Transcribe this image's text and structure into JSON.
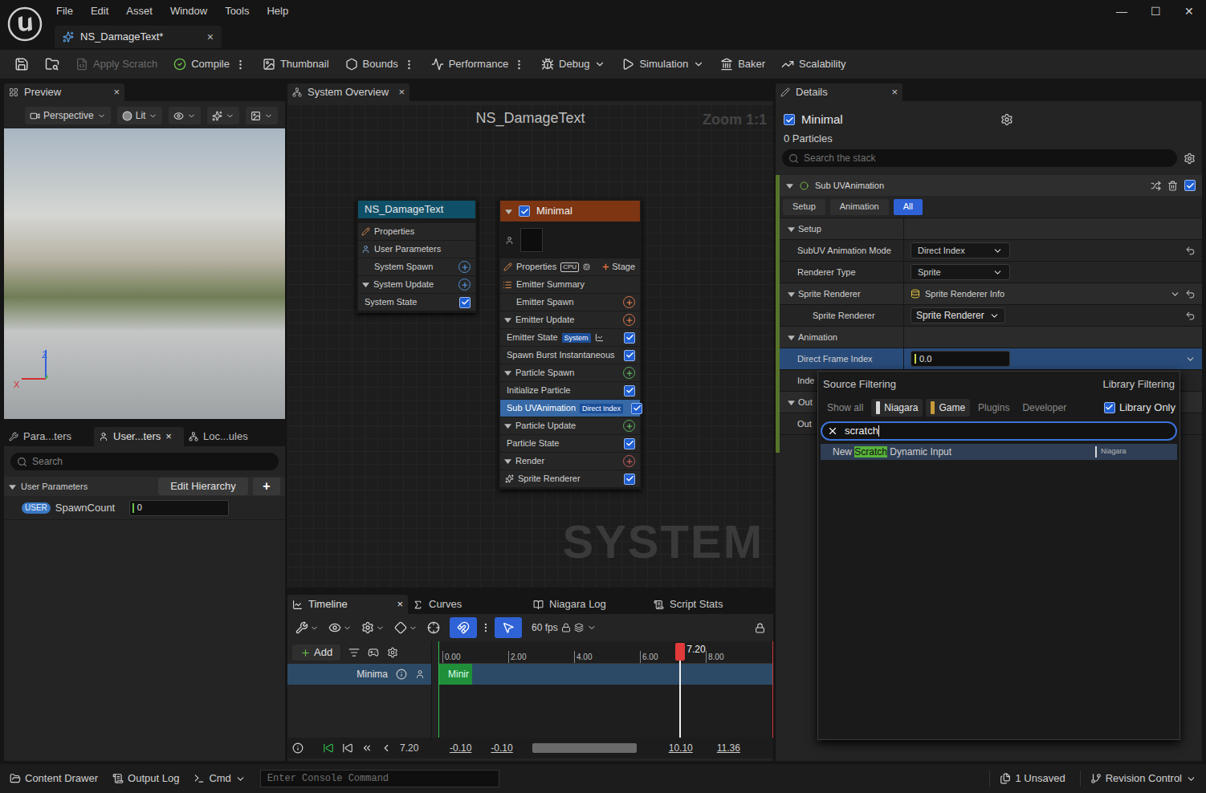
{
  "title_bar": {
    "menu": [
      "File",
      "Edit",
      "Asset",
      "Window",
      "Tools",
      "Help"
    ],
    "window_controls": [
      "—",
      "☐",
      "✕"
    ],
    "document_tab": {
      "label": "NS_DamageText*",
      "close": "×",
      "selected": true
    }
  },
  "toolbar": [
    {
      "label": "Apply Scratch",
      "disabled": true,
      "more": false,
      "dropdown": false
    },
    {
      "label": "Compile",
      "disabled": false,
      "more": true,
      "dropdown": false
    },
    {
      "label": "Thumbnail",
      "disabled": false,
      "more": false,
      "dropdown": false
    },
    {
      "label": "Bounds",
      "disabled": false,
      "more": true,
      "dropdown": false
    },
    {
      "label": "Performance",
      "disabled": false,
      "more": true,
      "dropdown": false
    },
    {
      "label": "Debug",
      "disabled": false,
      "more": false,
      "dropdown": true
    },
    {
      "label": "Simulation",
      "disabled": false,
      "more": false,
      "dropdown": true
    },
    {
      "label": "Baker",
      "disabled": false,
      "more": false,
      "dropdown": false
    },
    {
      "label": "Scalability",
      "disabled": false,
      "more": false,
      "dropdown": false
    }
  ],
  "preview": {
    "tab": "Preview",
    "close": "×",
    "view_options": [
      {
        "label": "Perspective"
      },
      {
        "label": "Lit"
      }
    ],
    "axis": {
      "z": "Z",
      "x": "X"
    }
  },
  "parameters_panel": {
    "tabs": [
      {
        "label": "Para...ters",
        "selected": false,
        "close": ""
      },
      {
        "label": "User...ters",
        "selected": true,
        "close": "×"
      },
      {
        "label": "Loc...ules",
        "selected": false,
        "close": ""
      }
    ],
    "search_placeholder": "Search",
    "section": {
      "label": "User Parameters",
      "expanded": true
    },
    "edit_button": "Edit Hierarchy",
    "add_button": "+",
    "params": [
      {
        "badge": "USER",
        "name": "SpawnCount",
        "value": "0"
      }
    ]
  },
  "system_overview": {
    "tab": "System Overview",
    "close": "×",
    "title": "NS_DamageText",
    "zoom": "Zoom 1:1",
    "watermark": "SYSTEM",
    "system_node": {
      "title": "NS_DamageText",
      "rows": [
        {
          "label": "Properties",
          "kind": "property",
          "selected": false
        },
        {
          "label": "User Parameters",
          "kind": "user",
          "selected": false
        },
        {
          "label": "System Spawn",
          "kind": "stage",
          "color": "#4f8fd0",
          "selected": false
        },
        {
          "label": "System Update",
          "kind": "group",
          "expanded": true,
          "color": "#4f8fd0",
          "selected": false
        },
        {
          "label": "System State",
          "kind": "module",
          "checked": true,
          "selected": false
        }
      ]
    },
    "emitter_node": {
      "title": "Minimal",
      "enabled": true,
      "rows": [
        {
          "label": "Properties",
          "kind": "property",
          "badge": "CPU",
          "action": "Stage",
          "color": "#e0703a",
          "selected": false
        },
        {
          "label": "Emitter Summary",
          "kind": "summary",
          "selected": false
        },
        {
          "label": "Emitter Spawn",
          "kind": "stage",
          "color": "#d9784a",
          "selected": false
        },
        {
          "label": "Emitter Update",
          "kind": "group",
          "expanded": true,
          "color": "#d9784a",
          "selected": false
        },
        {
          "label": "Emitter State",
          "kind": "module",
          "badge": "System",
          "linked": true,
          "checked": true,
          "selected": false
        },
        {
          "label": "Spawn Burst Instantaneous",
          "kind": "module",
          "checked": true,
          "selected": false
        },
        {
          "label": "Particle Spawn",
          "kind": "group",
          "expanded": true,
          "color": "#5fb35f",
          "selected": false
        },
        {
          "label": "Initialize Particle",
          "kind": "module",
          "checked": true,
          "selected": false
        },
        {
          "label": "Sub UVAnimation",
          "kind": "module",
          "badge": "Direct Index",
          "checked": true,
          "selected": true
        },
        {
          "label": "Particle Update",
          "kind": "group",
          "expanded": true,
          "color": "#5fb35f",
          "selected": false
        },
        {
          "label": "Particle State",
          "kind": "module",
          "checked": true,
          "selected": false
        },
        {
          "label": "Render",
          "kind": "group",
          "expanded": true,
          "color": "#c75b5b",
          "selected": false
        },
        {
          "label": "Sprite Renderer",
          "kind": "renderer",
          "checked": true,
          "selected": false
        }
      ]
    }
  },
  "timeline": {
    "tabs": [
      {
        "label": "Timeline",
        "selected": true,
        "close": "×"
      },
      {
        "label": "Curves",
        "selected": false,
        "close": ""
      },
      {
        "label": "Niagara Log",
        "selected": false,
        "close": ""
      },
      {
        "label": "Script Stats",
        "selected": false,
        "close": ""
      }
    ],
    "fps": "60 fps",
    "snap_on": true,
    "select_on": true,
    "add_button": "Add",
    "track": {
      "label": "Minima",
      "bar_label": "Minir",
      "bar_level": 0.1,
      "selected": true
    },
    "ruler": [
      "0.00",
      "2.00",
      "4.00",
      "6.00",
      "8.00"
    ],
    "playhead": {
      "time": "7.20",
      "level": 0.72
    },
    "footer": {
      "time": "7.20",
      "range": [
        "-0.10",
        "-0.10",
        "10.10",
        "11.36"
      ]
    }
  },
  "details": {
    "tab": "Details",
    "close": "×",
    "title": "Minimal",
    "enabled": true,
    "particles": "0 Particles",
    "search_placeholder": "Search the stack",
    "module": {
      "label": "Sub UVAnimation",
      "enabled": true
    },
    "filters": [
      {
        "label": "Setup",
        "selected": false
      },
      {
        "label": "Animation",
        "selected": false
      },
      {
        "label": "All",
        "selected": true
      }
    ],
    "rows": [
      {
        "kind": "category",
        "label": "Setup",
        "expanded": true,
        "depth": 0,
        "selected": false
      },
      {
        "kind": "dropdown",
        "label": "SubUV Animation Mode",
        "value": "Direct Index",
        "reset": true,
        "depth": 1,
        "selected": false
      },
      {
        "kind": "dropdown",
        "label": "Renderer Type",
        "value": "Sprite",
        "reset": false,
        "depth": 1,
        "selected": false
      },
      {
        "kind": "category_value",
        "label": "Sprite Renderer",
        "value": "Sprite Renderer Info",
        "expanded": true,
        "reset": true,
        "depth": 0,
        "selected": false
      },
      {
        "kind": "compact",
        "label": "Sprite Renderer",
        "value": "Sprite Renderer",
        "reset": true,
        "depth": 2,
        "selected": false
      },
      {
        "kind": "category",
        "label": "Animation",
        "expanded": true,
        "depth": 0,
        "selected": false
      },
      {
        "kind": "number",
        "label": "Direct Frame Index",
        "value": "0.0",
        "depth": 1,
        "selected": true
      },
      {
        "kind": "field",
        "label": "Inde",
        "depth": 1,
        "selected": false
      },
      {
        "kind": "category",
        "label": "Out",
        "expanded": true,
        "depth": 0,
        "selected": false
      },
      {
        "kind": "field",
        "label": "Out",
        "depth": 1,
        "selected": false
      }
    ]
  },
  "popup": {
    "source_label": "Source Filtering",
    "library_label": "Library Filtering",
    "chips": [
      {
        "label": "Show all",
        "selected": false,
        "color": ""
      },
      {
        "label": "Niagara",
        "selected": true,
        "color": "#d8d8d8"
      },
      {
        "label": "Game",
        "selected": true,
        "color": "#c89a3a"
      },
      {
        "label": "Plugins",
        "selected": false,
        "color": ""
      },
      {
        "label": "Developer",
        "selected": false,
        "color": ""
      }
    ],
    "library_only": {
      "label": "Library Only",
      "checked": true
    },
    "search": "scratch",
    "results": [
      {
        "parts": [
          {
            "text": "New ",
            "match": false
          },
          {
            "text": "Scratch",
            "match": true
          },
          {
            "text": " Dynamic Input",
            "match": false
          }
        ],
        "tag": "Niagara",
        "selected": true
      }
    ]
  },
  "status_bar": {
    "left": [
      {
        "label": "Content Drawer",
        "dropdown": false
      },
      {
        "label": "Output Log",
        "dropdown": false
      },
      {
        "label": "Cmd",
        "dropdown": true
      }
    ],
    "console_placeholder": "Enter Console Command",
    "right": [
      {
        "label": "1 Unsaved",
        "dropdown": false
      },
      {
        "label": "Revision Control",
        "dropdown": true
      }
    ]
  }
}
